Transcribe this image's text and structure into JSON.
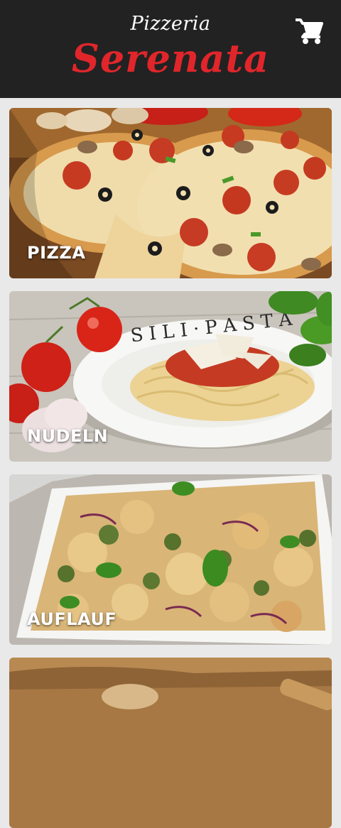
{
  "header": {
    "title_small": "Pizzeria",
    "title_big": "Serenata",
    "cart_icon": "shopping-cart-icon",
    "colors": {
      "background": "#222222",
      "brand_red": "#e0262b"
    }
  },
  "categories": [
    {
      "label": "PIZZA"
    },
    {
      "label": "NUDELN"
    },
    {
      "label": "AUFLAUF"
    },
    {
      "label": ""
    }
  ]
}
